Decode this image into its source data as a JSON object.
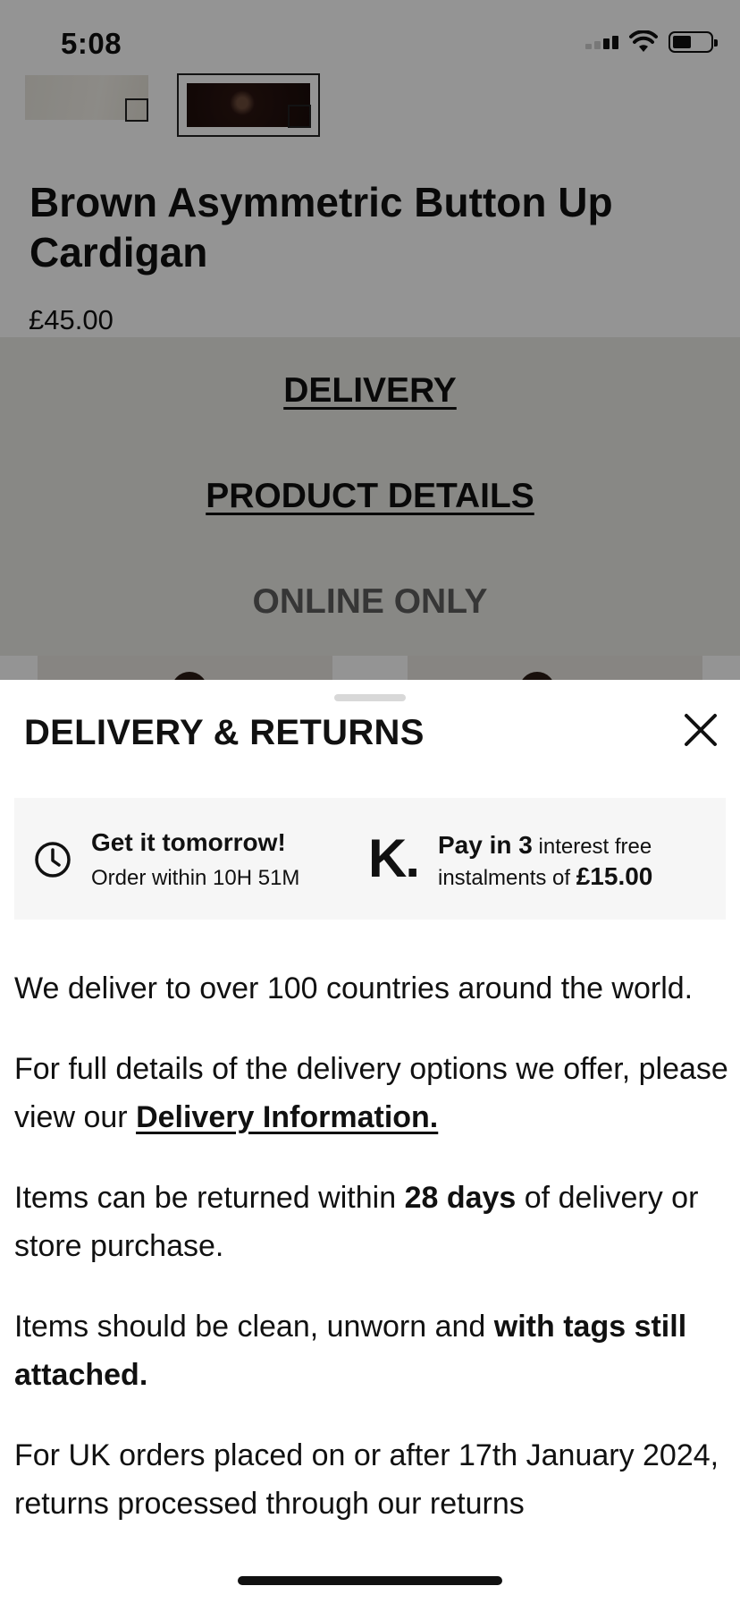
{
  "status_bar": {
    "time": "5:08"
  },
  "product": {
    "title": "Brown Asymmetric Button Up Cardigan",
    "price": "£45.00"
  },
  "tabs": {
    "delivery": "DELIVERY",
    "product_details": "PRODUCT DETAILS",
    "online_only": "ONLINE ONLY"
  },
  "sheet": {
    "title": "DELIVERY & RETURNS",
    "delivery_promo": {
      "headline": "Get it tomorrow!",
      "subline": "Order within 10H 51M"
    },
    "klarna_promo": {
      "logo": "K.",
      "pay_in": "Pay in 3",
      "interest": " interest free",
      "instalments": "instalments of ",
      "amount": "£15.00"
    },
    "paragraphs": {
      "p1": "We deliver to over 100 countries around the world.",
      "p2_pre": "For full details of the delivery options we offer, please view our ",
      "p2_link": "Delivery Information.",
      "p3_pre": "Items can be returned within ",
      "p3_bold": "28 days",
      "p3_post": " of delivery or store purchase.",
      "p4_pre": "Items should be clean, unworn and ",
      "p4_bold": "with tags still attached.",
      "p5": "For UK orders placed on or after 17th January 2024, returns processed through our returns"
    }
  },
  "icons": {
    "clock": "clock-icon",
    "close": "close-icon",
    "klarna": "klarna-logo-icon"
  }
}
